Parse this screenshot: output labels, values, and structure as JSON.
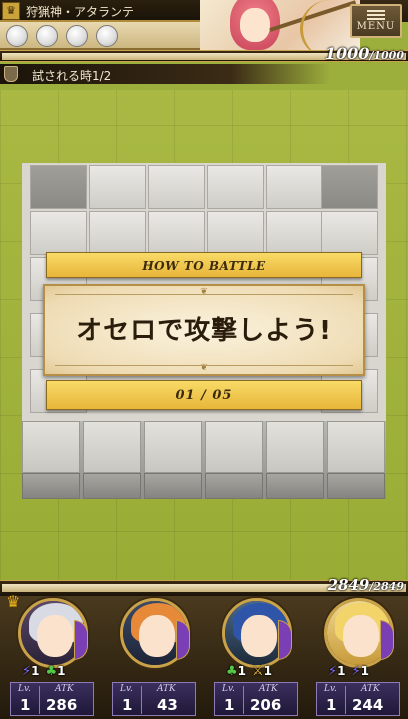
{
  "header": {
    "boss_name": "狩猟神・アタランテ",
    "menu_label": "MENU",
    "boss_hp_current": "1000",
    "boss_hp_max": "1000",
    "boss_hp_fraction": 1.0,
    "orbs": 4
  },
  "quest": {
    "text": "試される時1/2"
  },
  "dialog": {
    "title": "HOW TO BATTLE",
    "message": "オセロで攻撃しよう!",
    "page": "01 / 05"
  },
  "party": {
    "hp_current": "2849",
    "hp_max": "2849",
    "hp_fraction": 1.0,
    "lv_label": "Lv.",
    "atk_label": "ATK",
    "members": [
      {
        "level": "1",
        "atk": "286",
        "skills": [
          {
            "icon": "bolt",
            "value": "1"
          },
          {
            "icon": "clover",
            "value": "1"
          }
        ]
      },
      {
        "level": "1",
        "atk": "43",
        "skills": []
      },
      {
        "level": "1",
        "atk": "206",
        "skills": [
          {
            "icon": "clover",
            "value": "1"
          },
          {
            "icon": "sword",
            "value": "1"
          }
        ]
      },
      {
        "level": "1",
        "atk": "244",
        "skills": [
          {
            "icon": "bolt",
            "value": "1"
          },
          {
            "icon": "bolt",
            "value": "1"
          }
        ]
      }
    ]
  },
  "colors": {
    "accent_gold": "#e8b53a",
    "frame_brown": "#3a2913",
    "grass": "#9cae3c"
  }
}
